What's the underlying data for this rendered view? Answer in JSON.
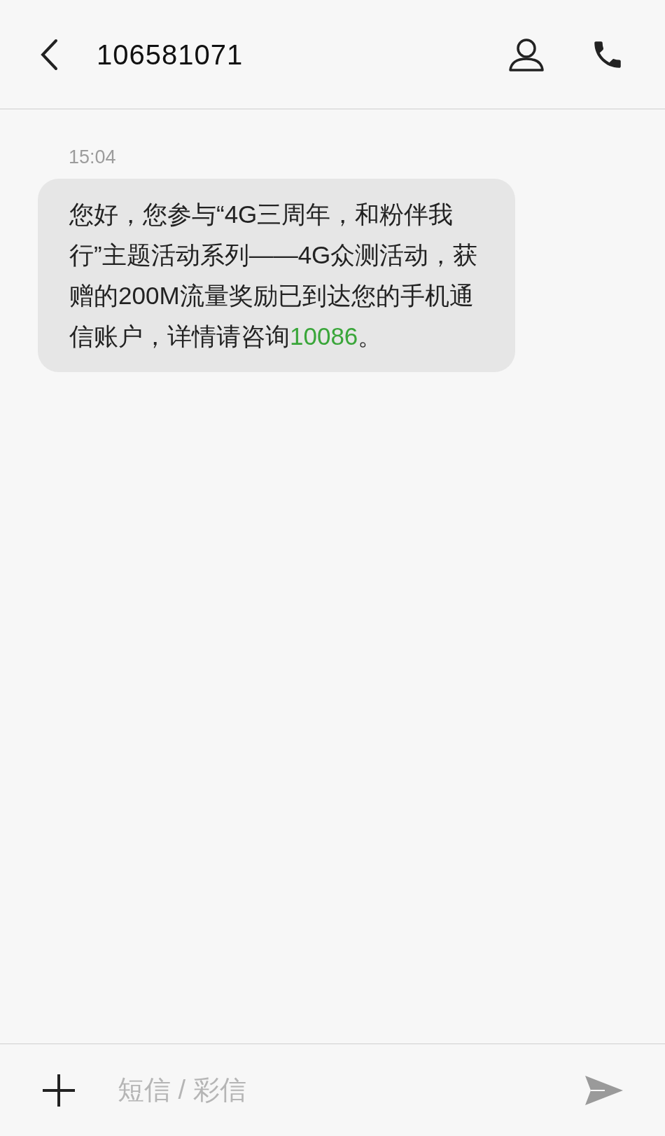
{
  "header": {
    "title": "106581071"
  },
  "messages": [
    {
      "time": "15:04",
      "text": "您好，您参与“4G三周年，和粉伴我行”主题活动系列——4G众测活动，获赠的200M流量奖励已到达您的手机通信账户，详情请咨询",
      "link": "10086",
      "end": "。"
    }
  ],
  "composer": {
    "placeholder": "短信 / 彩信"
  }
}
